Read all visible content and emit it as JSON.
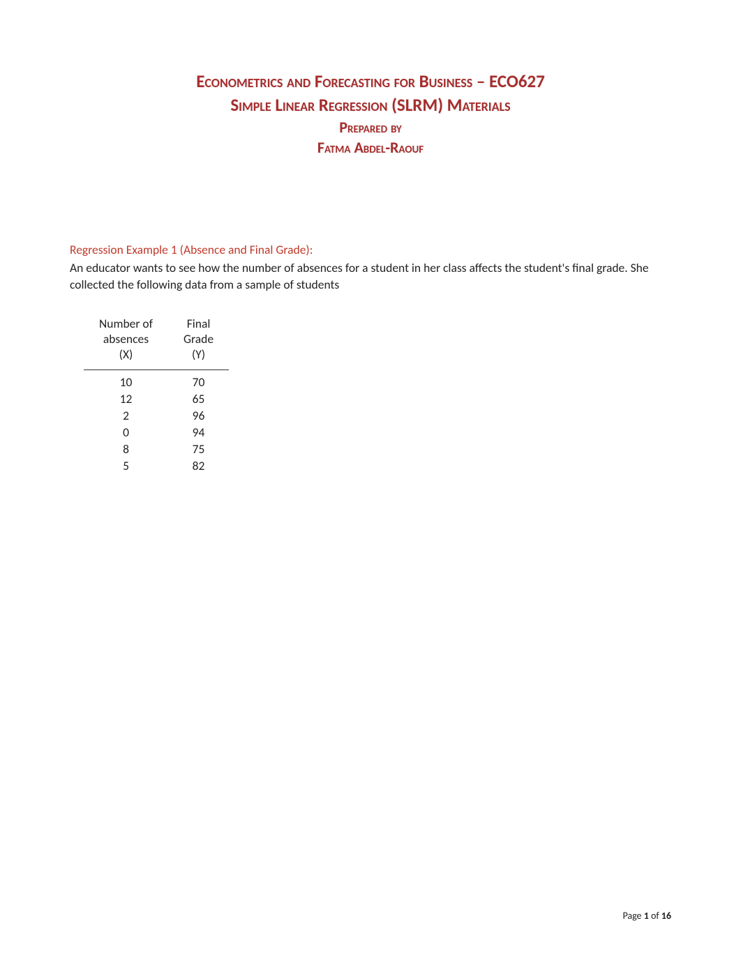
{
  "title": {
    "line1": "Econometrics and Forecasting for Business – ECO627",
    "line2": "Simple Linear Regression (SLRM) Materials",
    "line3": "Prepared by",
    "line4": "Fatma Abdel-Raouf"
  },
  "example": {
    "heading": "Regression Example 1 (Absence and Final Grade):",
    "body": "An educator wants to see how the number of absences for a student in her class affects the student's final grade. She collected the following data from a sample of students"
  },
  "table": {
    "headers": {
      "col1_line1": "Number of",
      "col1_line2": "absences",
      "col1_line3": "(X)",
      "col2_line1": "Final",
      "col2_line2": "Grade",
      "col2_line3": "(Y)"
    },
    "rows": [
      {
        "x": "10",
        "y": "70"
      },
      {
        "x": "12",
        "y": "65"
      },
      {
        "x": "2",
        "y": "96"
      },
      {
        "x": "0",
        "y": "94"
      },
      {
        "x": "8",
        "y": "75"
      },
      {
        "x": "5",
        "y": "82"
      }
    ]
  },
  "footer": {
    "prefix": "Page ",
    "current": "1",
    "of": " of ",
    "total": "16"
  }
}
